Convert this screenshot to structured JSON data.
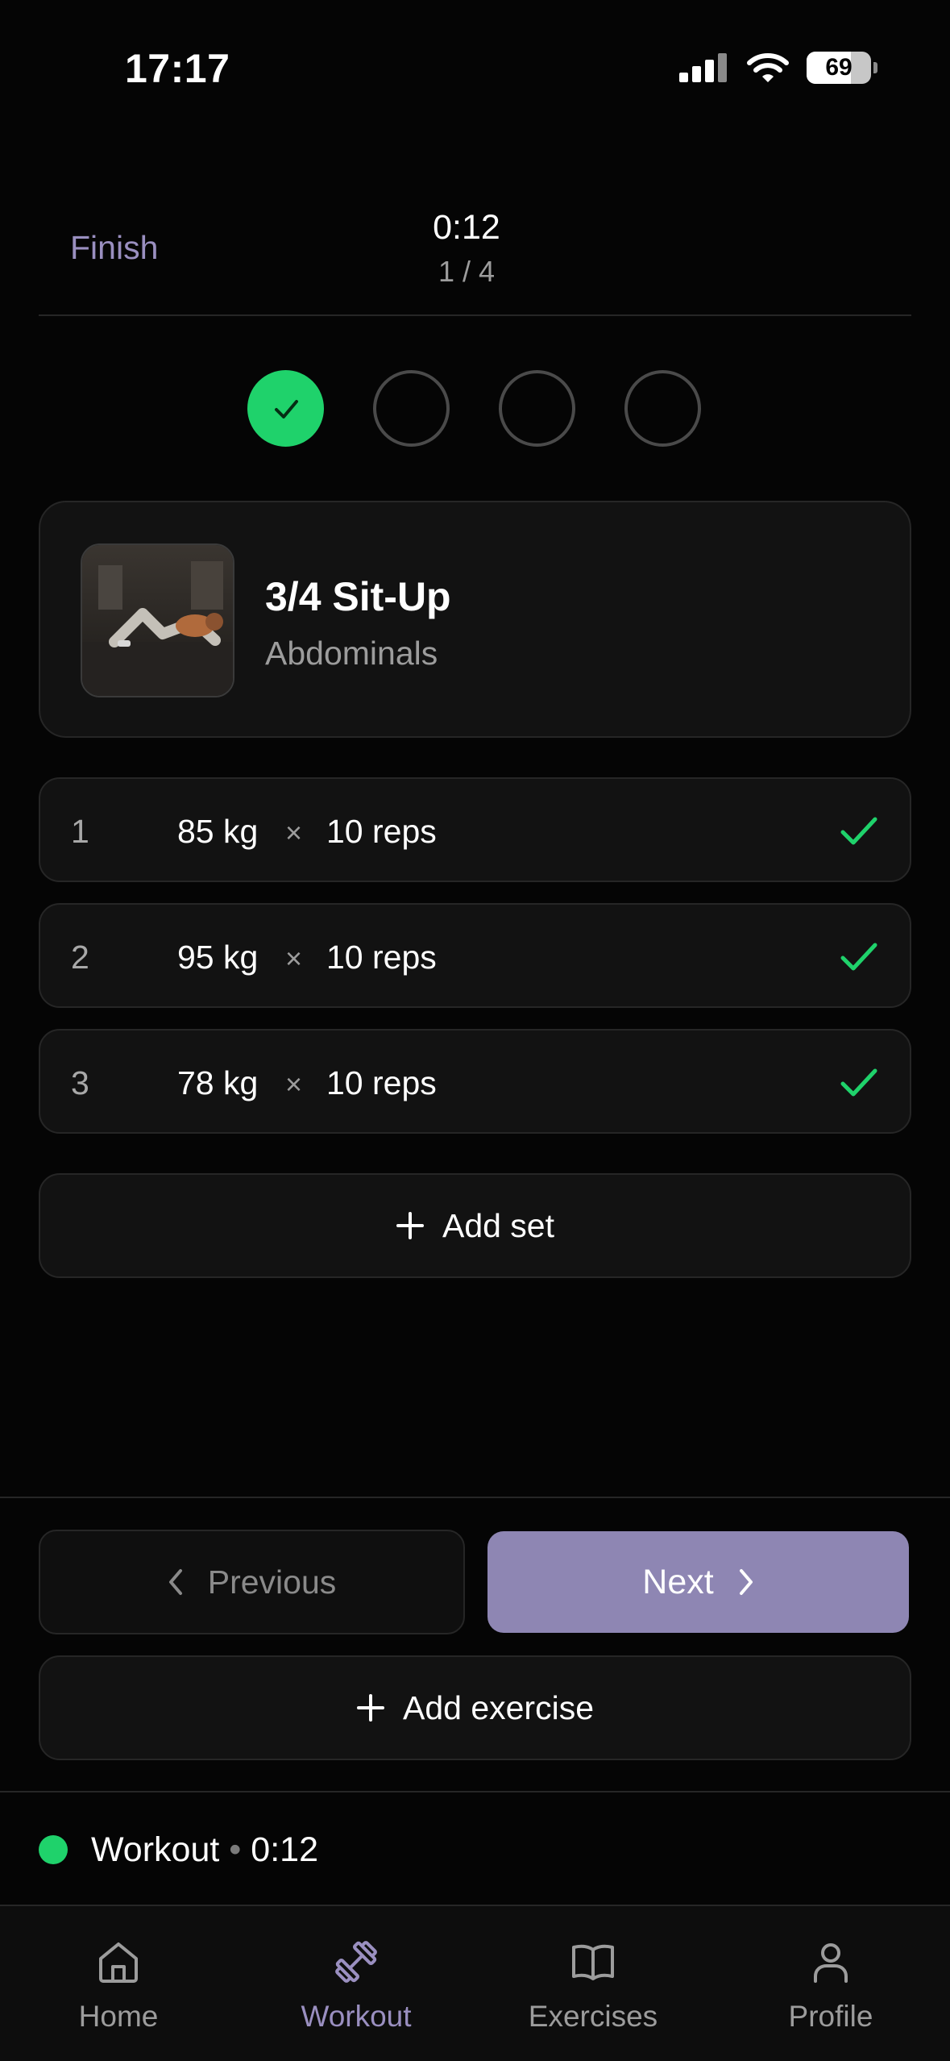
{
  "status": {
    "time": "17:17",
    "battery": "69",
    "battery_level": 0.69
  },
  "header": {
    "finish_label": "Finish",
    "timer": "0:12",
    "progress": "1 / 4"
  },
  "steps": [
    {
      "state": "done"
    },
    {
      "state": "pending"
    },
    {
      "state": "pending"
    },
    {
      "state": "pending"
    }
  ],
  "exercise": {
    "name": "3/4 Sit-Up",
    "muscle": "Abdominals"
  },
  "sets": [
    {
      "index": "1",
      "weight": "85 kg",
      "times": "×",
      "reps": "10 reps",
      "completed": true
    },
    {
      "index": "2",
      "weight": "95 kg",
      "times": "×",
      "reps": "10 reps",
      "completed": true
    },
    {
      "index": "3",
      "weight": "78 kg",
      "times": "×",
      "reps": "10 reps",
      "completed": true
    }
  ],
  "actions": {
    "add_set": "Add set",
    "previous": "Previous",
    "next": "Next",
    "add_exercise": "Add exercise"
  },
  "session": {
    "label": "Workout",
    "separator": "•",
    "time": "0:12"
  },
  "tabs": [
    {
      "label": "Home",
      "icon": "home-icon"
    },
    {
      "label": "Workout",
      "icon": "dumbbell-icon",
      "active": true
    },
    {
      "label": "Exercises",
      "icon": "book-icon"
    },
    {
      "label": "Profile",
      "icon": "user-icon"
    }
  ],
  "colors": {
    "accent": "#9a8fc0",
    "success": "#1fd26b",
    "next_button": "#8e86b3",
    "background": "#050505"
  }
}
